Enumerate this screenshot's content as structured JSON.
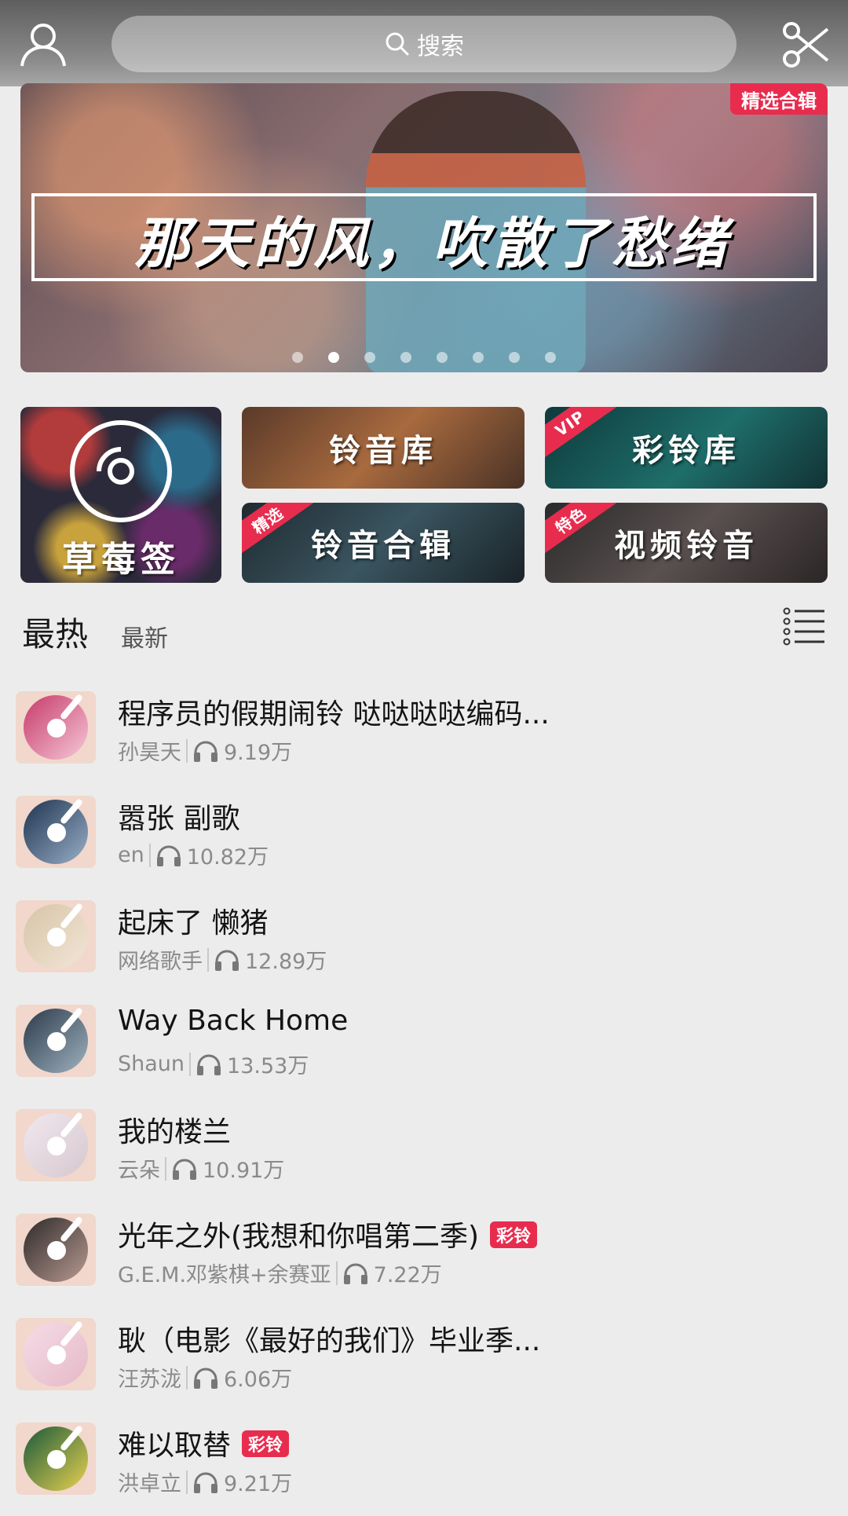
{
  "header": {
    "search_placeholder": "搜索",
    "icons": {
      "user": "user-icon",
      "search": "search-icon",
      "scissors": "scissors-icon"
    }
  },
  "banner": {
    "headline": "那天的风，吹散了愁绪",
    "tag": "精选合辑",
    "dots_count": 8,
    "active_dot": 1
  },
  "categories": {
    "caomeiqian": "草莓签",
    "lingyinku": "铃音库",
    "cailingku": "彩铃库",
    "cailingku_corner": "VIP",
    "lingyinheji": "铃音合辑",
    "lingyinheji_corner": "精选",
    "shipinlingyin": "视频铃音",
    "shipinlingyin_corner": "特色"
  },
  "tabs": {
    "hot": "最热",
    "new": "最新",
    "list_icon": "list-icon"
  },
  "colors": {
    "accent": "#e82c4e",
    "background": "#ececec",
    "thumb_bg": "#f1d7cc"
  },
  "songs": [
    {
      "title": "程序员的假期闹铃 哒哒哒哒编码...",
      "artist": "孙昊天",
      "plays": "9.19万",
      "badge": ""
    },
    {
      "title": "嚣张 副歌",
      "artist": "en",
      "plays": "10.82万",
      "badge": ""
    },
    {
      "title": "起床了 懒猪",
      "artist": "网络歌手",
      "plays": "12.89万",
      "badge": ""
    },
    {
      "title": "Way Back Home",
      "artist": "Shaun",
      "plays": "13.53万",
      "badge": ""
    },
    {
      "title": "我的楼兰",
      "artist": "云朵",
      "plays": "10.91万",
      "badge": ""
    },
    {
      "title": "光年之外(我想和你唱第二季)",
      "artist": "G.E.M.邓紫棋+余赛亚",
      "plays": "7.22万",
      "badge": "彩铃"
    },
    {
      "title": "耿（电影《最好的我们》毕业季...",
      "artist": "汪苏泷",
      "plays": "6.06万",
      "badge": ""
    },
    {
      "title": "难以取替",
      "artist": "洪卓立",
      "plays": "9.21万",
      "badge": "彩铃"
    }
  ]
}
